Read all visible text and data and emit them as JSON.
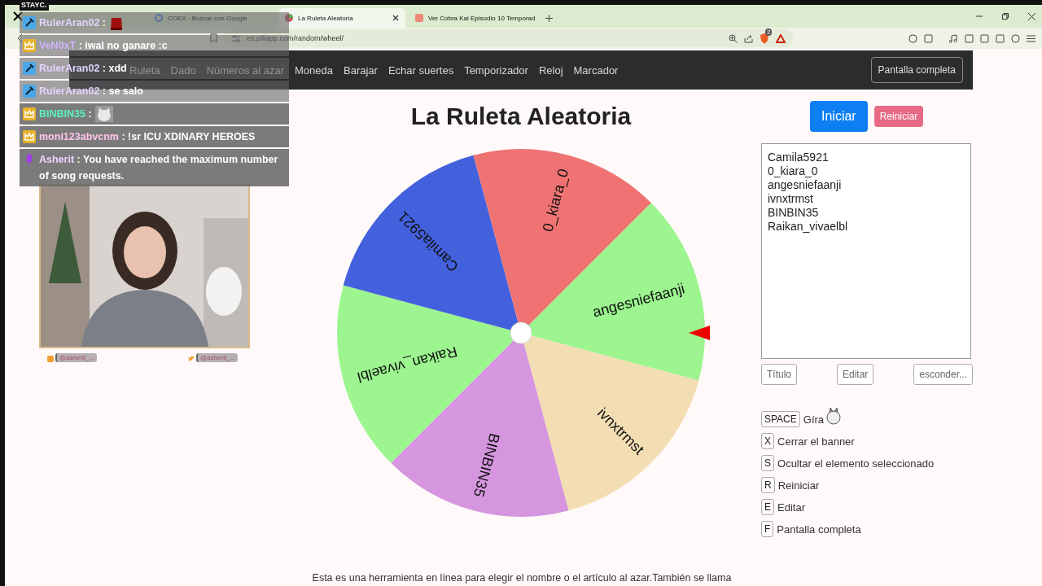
{
  "stream_banner": "STAYC.",
  "browser": {
    "tabs": [
      {
        "title": "COEX - Buscar con Google",
        "selected": false
      },
      {
        "title": "La Ruleta Aleatoria",
        "selected": true
      },
      {
        "title": "Ver Cobra Kai Episodio 10 Temporad",
        "selected": false
      }
    ],
    "url": "es.piliapp.com/random/wheel/",
    "shield_count": "2"
  },
  "nav": {
    "items": [
      {
        "label": "Ruleta"
      },
      {
        "label": "Dado"
      },
      {
        "label": "Números al azar"
      },
      {
        "label": "Moneda"
      },
      {
        "label": "Barajar"
      },
      {
        "label": "Echar suertes"
      },
      {
        "label": "Temporizador"
      },
      {
        "label": "Reloj"
      },
      {
        "label": "Marcador"
      }
    ],
    "fullscreen_button": "Pantalla completa"
  },
  "title": "La Ruleta Aleatoria",
  "wheel": {
    "slices": [
      {
        "label": "angesniefaanji",
        "color": "#9cf58f"
      },
      {
        "label": "ivnxtrmst",
        "color": "#f3ddb3"
      },
      {
        "label": "BINBIN35",
        "color": "#d596df"
      },
      {
        "label": "Raikan_vivaelbl",
        "color": "#9cf58f"
      },
      {
        "label": "Camila5921",
        "color": "#4361dc"
      },
      {
        "label": "0_kiara_0",
        "color": "#ef7373"
      }
    ]
  },
  "start_button": "Iniciar",
  "reset_button": "Reiniciar",
  "names_field": {
    "value": [
      "Camila5921",
      "0_kiara_0",
      "angesniefaanji",
      "ivnxtrmst",
      "BINBIN35",
      "Raikan_vivaelbl"
    ]
  },
  "list_buttons": [
    "Título",
    "Editar",
    "esconder..."
  ],
  "shortcuts": [
    {
      "key": "SPACE",
      "label": "Gíra"
    },
    {
      "key": "X",
      "label": "Cerrar el banner"
    },
    {
      "key": "S",
      "label": "Ocultar el elemento seleccionado"
    },
    {
      "key": "R",
      "label": "Reiniciar"
    },
    {
      "key": "E",
      "label": "Editar"
    },
    {
      "key": "F",
      "label": "Pantalla completa"
    }
  ],
  "footer_text": "Esta es una herramienta en línea para elegir el nombre o el artículo al azar.También se llama",
  "chat": [
    {
      "kind": "tool",
      "user": "RulerAran02",
      "color": "#e2d4ff",
      "separator": ":"
    },
    {
      "kind": "crown",
      "user": "VeN0xT",
      "color": "#d2b4ff",
      "separator": ":",
      "message": "iwal no ganare :c"
    },
    {
      "kind": "tool",
      "user": "RulerAran02",
      "color": "#e2d4ff",
      "separator": ":",
      "message": "xdd"
    },
    {
      "kind": "tool",
      "user": "RulerAran02",
      "color": "#e2d4ff",
      "separator": ":",
      "message": "se salo"
    },
    {
      "kind": "crown",
      "user": "BINBIN35",
      "color": "#5cf2c0",
      "separator": ":"
    },
    {
      "kind": "crown",
      "user": "moni123abvcnm",
      "color": "#ffc6e8",
      "separator": ":",
      "message": "!sr ICU XDINARY HEROES"
    },
    {
      "kind": "mic",
      "user": "Asherit",
      "color": "#ecd2ff",
      "separator": ":",
      "message": "You have reached the maximum number of song requests."
    }
  ],
  "webcam": {
    "handles": [
      "@asherit_...",
      "@asherit_..."
    ]
  }
}
